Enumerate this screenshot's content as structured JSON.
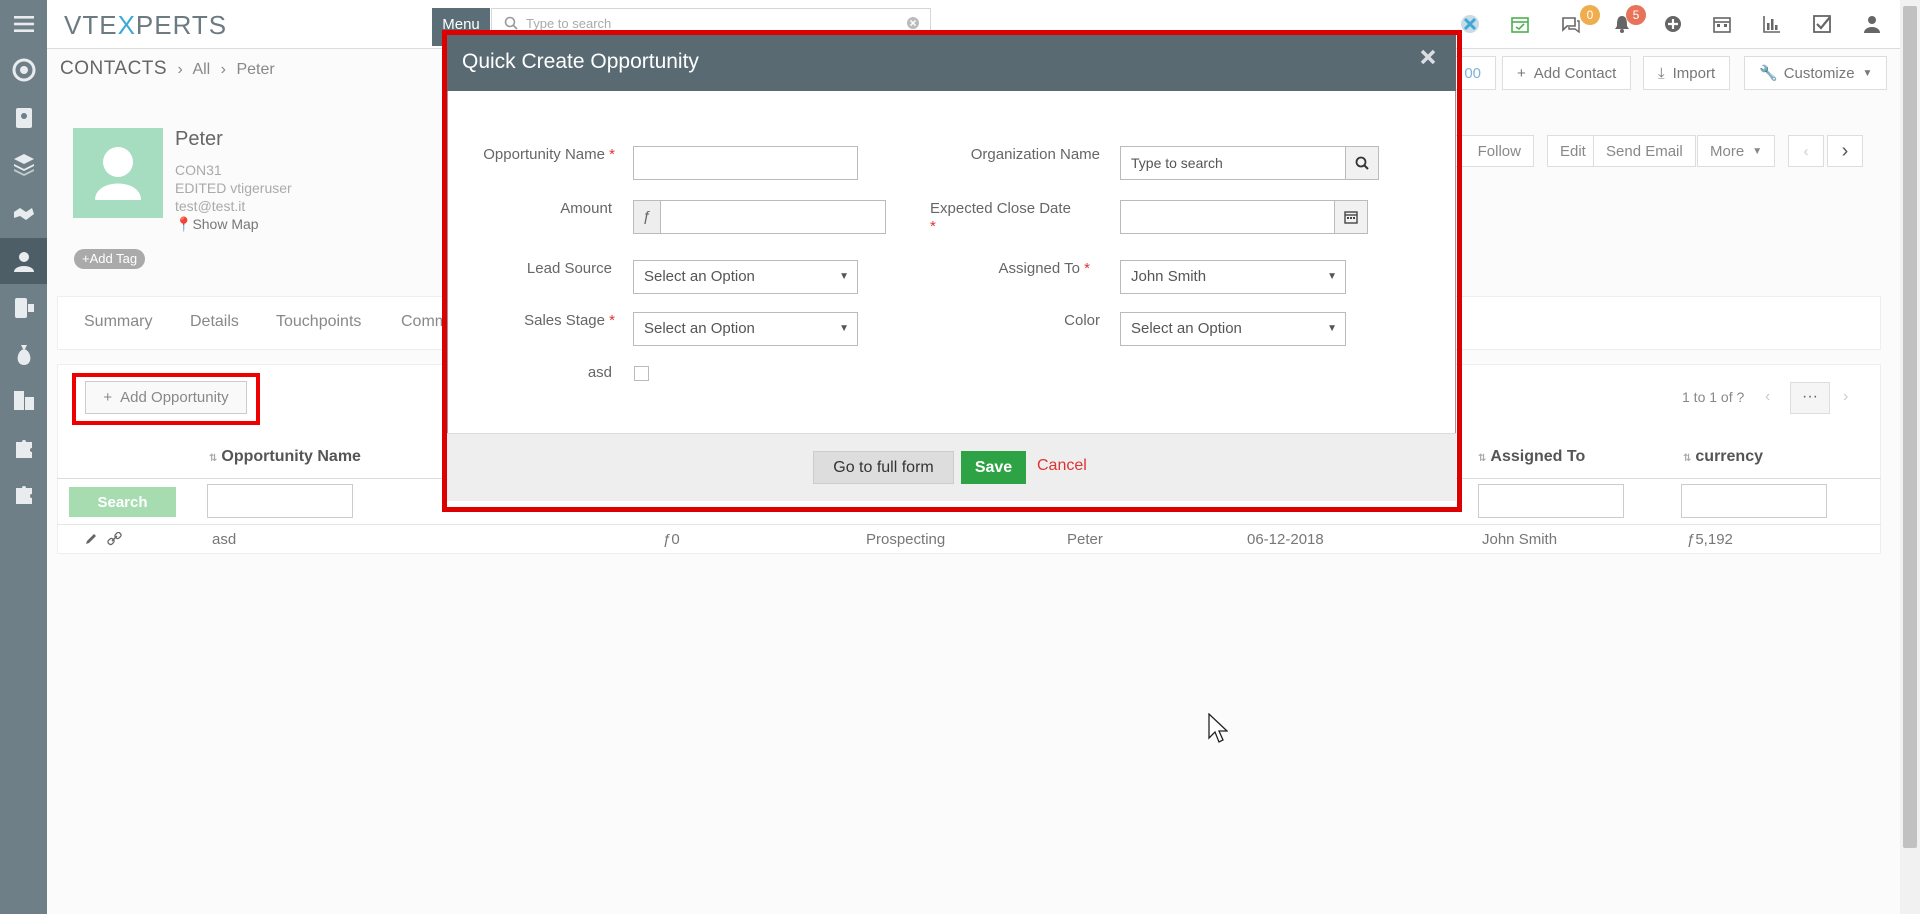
{
  "app": {
    "logo_pre": "VTE",
    "logo_x": "X",
    "logo_post": "PERTS"
  },
  "topbar": {
    "menu_label": "Menu",
    "search_placeholder": "Type to search",
    "chat_count": "0",
    "notif_count": "5"
  },
  "breadcrumb": {
    "module": "CONTACTS",
    "all": "All",
    "record": "Peter"
  },
  "header_buttons": {
    "partial": "00",
    "add_contact": "Add Contact",
    "import": "Import",
    "customize": "Customize"
  },
  "contact": {
    "name": "Peter",
    "id": "CON31",
    "edited": "EDITED vtigeruser",
    "email": "test@test.it",
    "show_map": "Show Map",
    "add_tag": "Add Tag"
  },
  "record_actions": {
    "follow": "Follow",
    "edit": "Edit",
    "send_email": "Send Email",
    "more": "More"
  },
  "tabs": [
    "Summary",
    "Details",
    "Touchpoints",
    "Comm"
  ],
  "related": {
    "add_button": "Add Opportunity",
    "search_button": "Search",
    "pager": "1 to 1 of ?",
    "columns": {
      "name": "Opportunity Name",
      "assigned": "Assigned To",
      "currency": "currency"
    },
    "row": {
      "name": "asd",
      "amount": "ƒ0",
      "stage": "Prospecting",
      "contact": "Peter",
      "date": "06-12-2018",
      "assigned": "John Smith",
      "currency": "ƒ5,192"
    }
  },
  "modal": {
    "title": "Quick Create Opportunity",
    "fields": {
      "opp_name": "Opportunity Name",
      "org_name": "Organization Name",
      "org_placeholder": "Type to search",
      "amount": "Amount",
      "currency_symbol": "ƒ",
      "close_date": "Expected Close Date",
      "lead_source": "Lead Source",
      "lead_source_value": "Select an Option",
      "assigned_to": "Assigned To",
      "assigned_to_value": "John Smith",
      "sales_stage": "Sales Stage",
      "sales_stage_value": "Select an Option",
      "color": "Color",
      "color_value": "Select an Option",
      "asd": "asd"
    },
    "footer": {
      "full_form": "Go to full form",
      "save": "Save",
      "cancel": "Cancel"
    }
  },
  "colors": {
    "sidebar": "#6e7f87",
    "modal_header": "#596a73",
    "save": "#2ea345",
    "highlight": "#dd0000"
  }
}
